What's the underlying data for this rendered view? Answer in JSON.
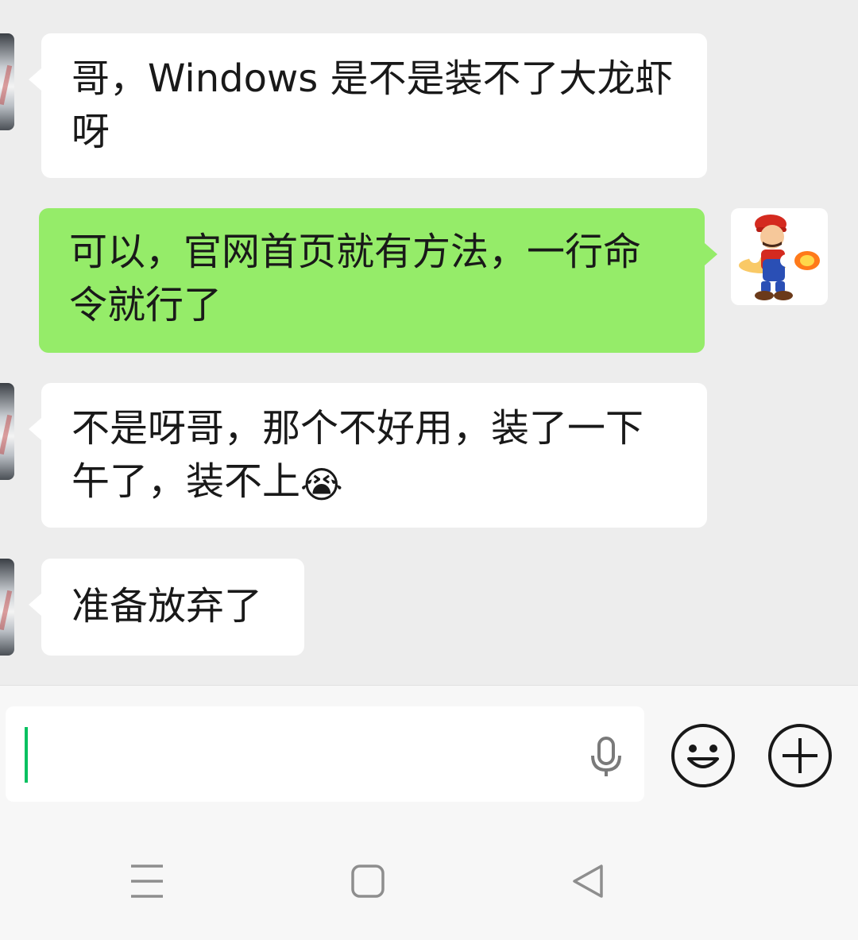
{
  "chat": {
    "messages": [
      {
        "side": "left",
        "lines": [
          "哥，Windows 是不是装不了大龙虾",
          "呀"
        ]
      },
      {
        "side": "right",
        "lines": [
          "可以，官网首页就有方法，一行命",
          "令就行了"
        ]
      },
      {
        "side": "left",
        "lines": [
          "不是呀哥，那个不好用，装了一下",
          "午了，装不上"
        ],
        "emoji": "😭"
      },
      {
        "side": "left",
        "lines": [
          "准备放弃了"
        ]
      }
    ]
  },
  "input_bar": {
    "text_value": "",
    "icons": [
      "voice-mic-icon",
      "emoji-icon",
      "plus-icon"
    ]
  },
  "nav_bar": {
    "icons": [
      "menu-lines-icon",
      "home-square-icon",
      "back-triangle-icon"
    ]
  },
  "colors": {
    "background": "#ededed",
    "incoming_bubble": "#ffffff",
    "outgoing_bubble": "#95ec69",
    "caret": "#07c160"
  }
}
